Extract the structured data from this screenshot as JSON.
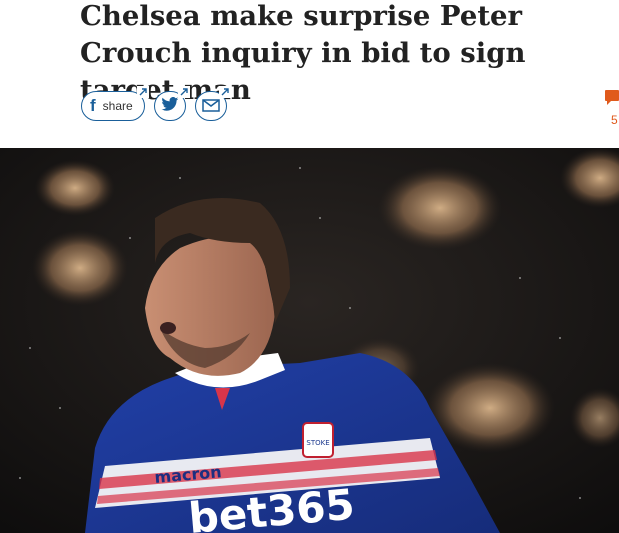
{
  "article": {
    "headline": "Chelsea make surprise Peter Crouch inquiry in bid to sign target man"
  },
  "share": {
    "facebook_label": "share",
    "facebook_glyph": "f",
    "icons": [
      "facebook-icon",
      "twitter-icon",
      "email-icon"
    ],
    "accent_color": "#1a5f9a"
  },
  "comments": {
    "count": "5",
    "icon": "comment-icon",
    "color": "#e05a1c"
  },
  "hero_image": {
    "shirt_sponsor_brand": "macron",
    "shirt_sponsor_main": "bet365",
    "club_crest_text": "STOKE CITY"
  }
}
